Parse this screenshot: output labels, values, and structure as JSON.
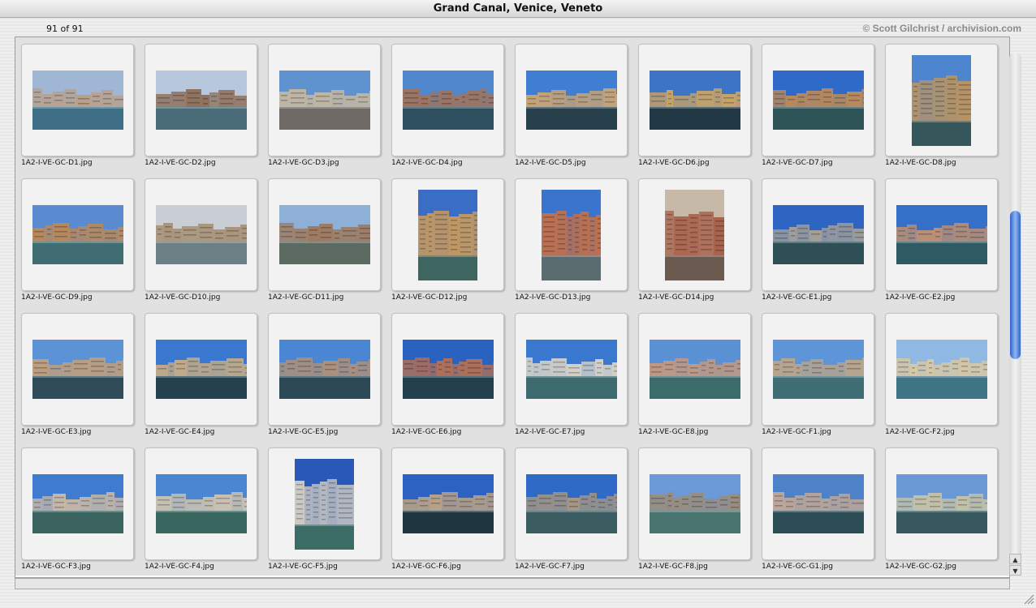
{
  "window": {
    "title": "Grand Canal, Venice, Veneto"
  },
  "header": {
    "counter": "91 of 91",
    "copyright": "© Scott Gilchrist / archivision.com"
  },
  "thumbnails": [
    {
      "file": "1A2-I-VE-GC-D1.jpg",
      "orientation": "landscape",
      "sky": "#9fb6d4",
      "water": "#3f6f86",
      "build": "#b8a08a"
    },
    {
      "file": "1A2-I-VE-GC-D2.jpg",
      "orientation": "landscape",
      "sky": "#b7c8dc",
      "water": "#4a6c78",
      "build": "#8e6f5a"
    },
    {
      "file": "1A2-I-VE-GC-D3.jpg",
      "orientation": "landscape",
      "sky": "#5f93d0",
      "water": "#6f6a66",
      "build": "#c9b9a0"
    },
    {
      "file": "1A2-I-VE-GC-D4.jpg",
      "orientation": "landscape",
      "sky": "#4f86cc",
      "water": "#2e4f5e",
      "build": "#a2735a"
    },
    {
      "file": "1A2-I-VE-GC-D5.jpg",
      "orientation": "landscape",
      "sky": "#3f7ed0",
      "water": "#28404c",
      "build": "#c7a477"
    },
    {
      "file": "1A2-I-VE-GC-D6.jpg",
      "orientation": "landscape",
      "sky": "#3d74c4",
      "water": "#223845",
      "build": "#c9a468"
    },
    {
      "file": "1A2-I-VE-GC-D7.jpg",
      "orientation": "landscape",
      "sky": "#2f6ac8",
      "water": "#2f5458",
      "build": "#b98a5c"
    },
    {
      "file": "1A2-I-VE-GC-D8.jpg",
      "orientation": "portrait",
      "sky": "#4d86cf",
      "water": "#35575c",
      "build": "#b99462"
    },
    {
      "file": "1A2-I-VE-GC-D9.jpg",
      "orientation": "landscape",
      "sky": "#5a8ad0",
      "water": "#3f6d72",
      "build": "#b9895a"
    },
    {
      "file": "1A2-I-VE-GC-D10.jpg",
      "orientation": "landscape",
      "sky": "#c9ced4",
      "water": "#6c7f84",
      "build": "#a48a6c"
    },
    {
      "file": "1A2-I-VE-GC-D11.jpg",
      "orientation": "landscape",
      "sky": "#8fb0d6",
      "water": "#5c6a62",
      "build": "#9e7a5e"
    },
    {
      "file": "1A2-I-VE-GC-D12.jpg",
      "orientation": "portrait",
      "sky": "#3a6ec6",
      "water": "#3e6660",
      "build": "#c99a5e"
    },
    {
      "file": "1A2-I-VE-GC-D13.jpg",
      "orientation": "portrait",
      "sky": "#3a74cc",
      "water": "#5a6c70",
      "build": "#c2704a"
    },
    {
      "file": "1A2-I-VE-GC-D14.jpg",
      "orientation": "portrait",
      "sky": "#c6b9a8",
      "water": "#6a5a50",
      "build": "#a8614a"
    },
    {
      "file": "1A2-I-VE-GC-E1.jpg",
      "orientation": "landscape",
      "sky": "#2e64c2",
      "water": "#2f4f56",
      "build": "#a4a09a"
    },
    {
      "file": "1A2-I-VE-GC-E2.jpg",
      "orientation": "landscape",
      "sky": "#3470c8",
      "water": "#2e5a64",
      "build": "#c09072"
    },
    {
      "file": "1A2-I-VE-GC-E3.jpg",
      "orientation": "landscape",
      "sky": "#5c92d6",
      "water": "#2f4c58",
      "build": "#c4a07a"
    },
    {
      "file": "1A2-I-VE-GC-E4.jpg",
      "orientation": "landscape",
      "sky": "#3a78d0",
      "water": "#25414e",
      "build": "#c4ab88"
    },
    {
      "file": "1A2-I-VE-GC-E5.jpg",
      "orientation": "landscape",
      "sky": "#4a86d4",
      "water": "#2c4a56",
      "build": "#b09078"
    },
    {
      "file": "1A2-I-VE-GC-E6.jpg",
      "orientation": "landscape",
      "sky": "#2a62c0",
      "water": "#23404c",
      "build": "#b07058"
    },
    {
      "file": "1A2-I-VE-GC-E7.jpg",
      "orientation": "landscape",
      "sky": "#3a78cf",
      "water": "#3c6a6e",
      "build": "#d6d2c8"
    },
    {
      "file": "1A2-I-VE-GC-E8.jpg",
      "orientation": "landscape",
      "sky": "#5a90d4",
      "water": "#3c6c6a",
      "build": "#c69a7e"
    },
    {
      "file": "1A2-I-VE-GC-F1.jpg",
      "orientation": "landscape",
      "sky": "#5d95d8",
      "water": "#3f6f74",
      "build": "#b8a48c"
    },
    {
      "file": "1A2-I-VE-GC-F2.jpg",
      "orientation": "landscape",
      "sky": "#8fb8e2",
      "water": "#3f7484",
      "build": "#d8c8a4"
    },
    {
      "file": "1A2-I-VE-GC-F3.jpg",
      "orientation": "landscape",
      "sky": "#3f7cd0",
      "water": "#3b6460",
      "build": "#c8b8a8"
    },
    {
      "file": "1A2-I-VE-GC-F4.jpg",
      "orientation": "landscape",
      "sky": "#4a86d2",
      "water": "#3a6660",
      "build": "#d2c6b0"
    },
    {
      "file": "1A2-I-VE-GC-F5.jpg",
      "orientation": "portrait",
      "sky": "#2858b8",
      "water": "#3c6c66",
      "build": "#d0ccc4"
    },
    {
      "file": "1A2-I-VE-GC-F6.jpg",
      "orientation": "landscape",
      "sky": "#2d62c2",
      "water": "#1f3640",
      "build": "#c9aa80"
    },
    {
      "file": "1A2-I-VE-GC-F7.jpg",
      "orientation": "landscape",
      "sky": "#2f6ac6",
      "water": "#3a5c60",
      "build": "#a89882"
    },
    {
      "file": "1A2-I-VE-GC-F8.jpg",
      "orientation": "landscape",
      "sky": "#6a9ad8",
      "water": "#4a7470",
      "build": "#9a8c7c"
    },
    {
      "file": "1A2-I-VE-GC-G1.jpg",
      "orientation": "landscape",
      "sky": "#4e82c8",
      "water": "#2c4c56",
      "build": "#c0a898"
    },
    {
      "file": "1A2-I-VE-GC-G2.jpg",
      "orientation": "landscape",
      "sky": "#6a9ad6",
      "water": "#36585e",
      "build": "#c6c2a8"
    }
  ]
}
